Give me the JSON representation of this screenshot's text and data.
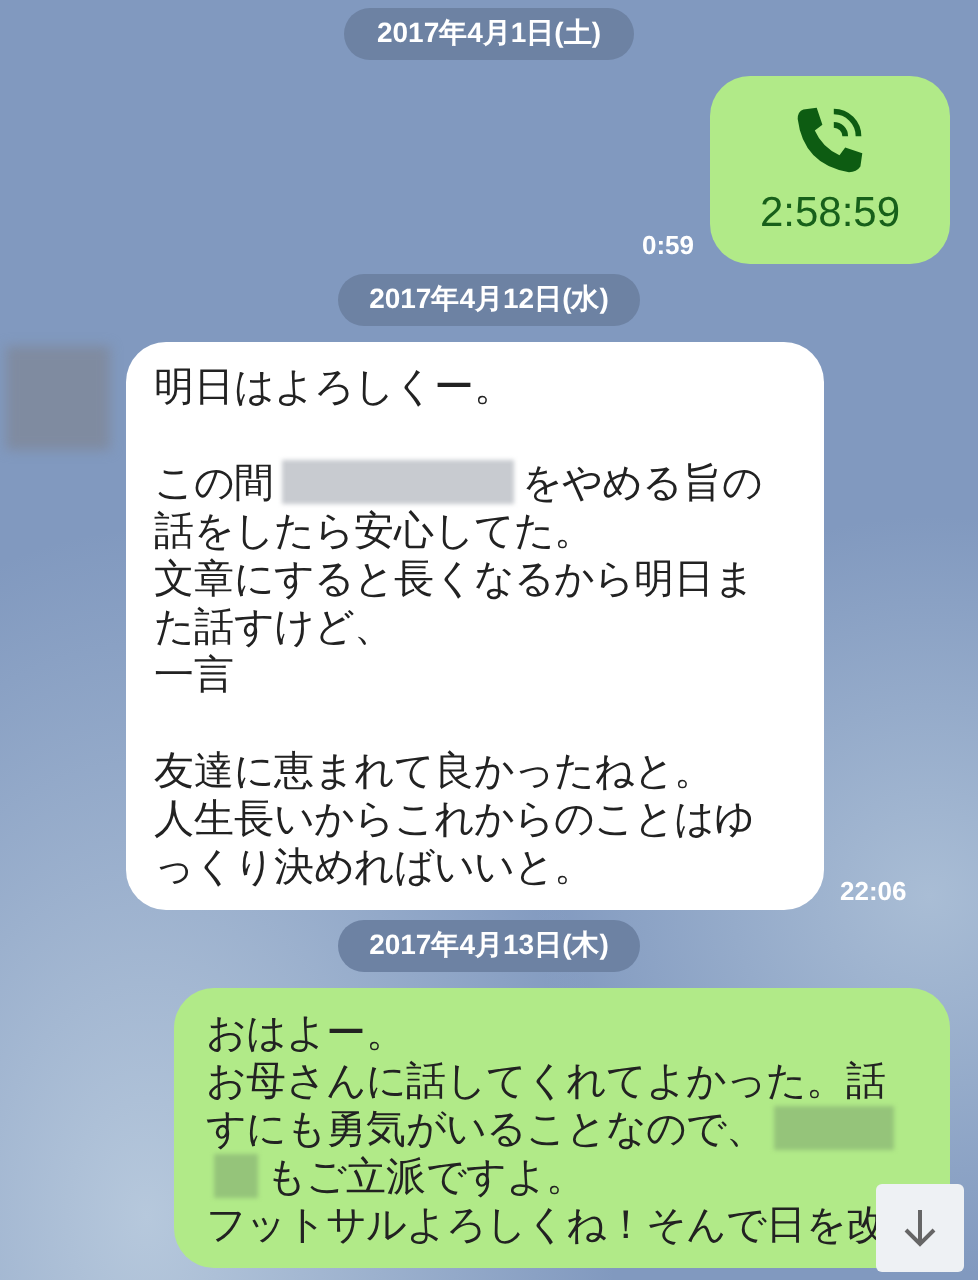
{
  "messages": [
    {
      "kind": "date",
      "text": "2017年4月1日(土)"
    },
    {
      "kind": "call",
      "outgoing": true,
      "duration": "2:58:59",
      "time": "0:59"
    },
    {
      "kind": "date",
      "text": "2017年4月12日(水)"
    },
    {
      "kind": "text",
      "outgoing": false,
      "time": "22:06",
      "paragraphs": [
        [
          [
            {
              "kind": "text",
              "text": "明日はよろしくー。"
            }
          ]
        ],
        [
          [
            {
              "kind": "text",
              "text": "この間"
            },
            {
              "kind": "longredaction"
            },
            {
              "kind": "text",
              "text": "をやめる旨の"
            }
          ],
          [
            {
              "kind": "text",
              "text": "話をしたら安心してた。"
            }
          ],
          [
            {
              "kind": "text",
              "text": "文章にすると長くなるから明日ま"
            }
          ],
          [
            {
              "kind": "text",
              "text": "た話すけど、"
            }
          ],
          [
            {
              "kind": "text",
              "text": "一言"
            }
          ]
        ],
        [
          [
            {
              "kind": "text",
              "text": "友達に恵まれて良かったねと。"
            }
          ],
          [
            {
              "kind": "text",
              "text": "人生長いからこれからのことはゆ"
            }
          ],
          [
            {
              "kind": "text",
              "text": "っくり決めればいいと。"
            }
          ]
        ]
      ]
    },
    {
      "kind": "date",
      "text": "2017年4月13日(木)"
    },
    {
      "kind": "text",
      "outgoing": true,
      "paragraphs": [
        [
          [
            {
              "kind": "text",
              "text": "おはよー。"
            }
          ],
          [
            {
              "kind": "text",
              "text": "お母さんに話してくれてよかった。話"
            }
          ],
          [
            {
              "kind": "text",
              "text": "すにも勇気がいることなので、"
            },
            {
              "kind": "redaction"
            }
          ],
          [
            {
              "kind": "shortredaction"
            },
            {
              "kind": "text",
              "text": "もご立派ですよ。"
            }
          ],
          [
            {
              "kind": "text",
              "text": "フットサルよろしくね！そんで日を改"
            }
          ]
        ]
      ]
    }
  ]
}
